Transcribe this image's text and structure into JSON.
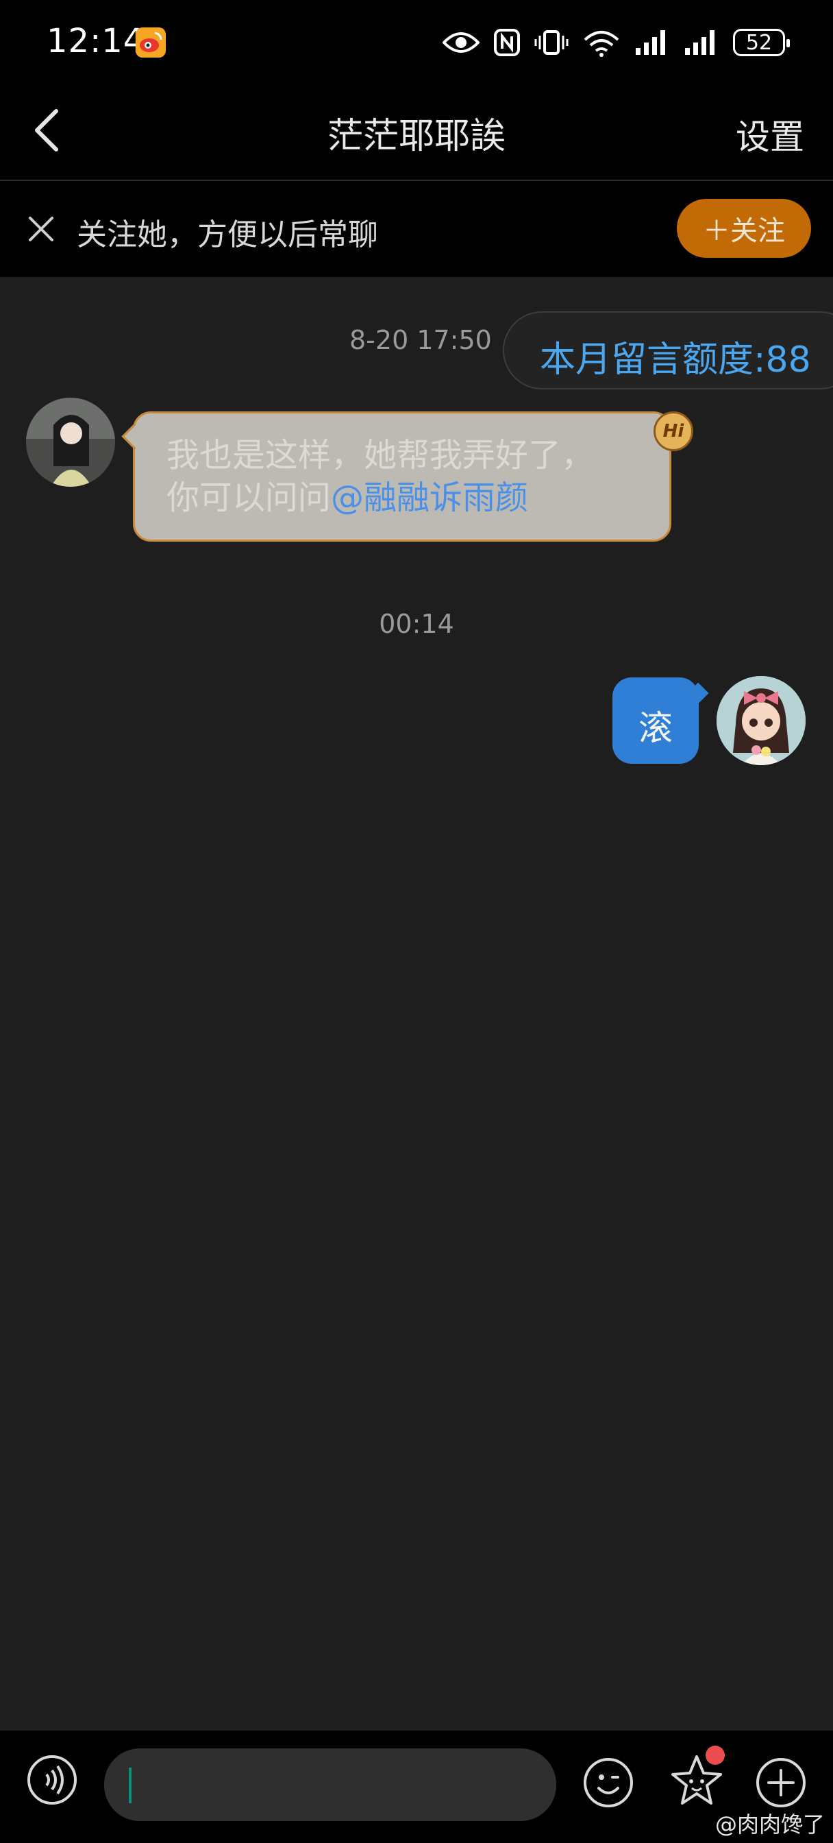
{
  "status_bar": {
    "time": "12:14",
    "battery": "52"
  },
  "nav": {
    "title": "茫茫耶耶誒",
    "settings_label": "设置"
  },
  "follow_banner": {
    "text": "关注她，方便以后常聊",
    "button_label": "＋关注"
  },
  "chat": {
    "timestamp_1": "8-20 17:50",
    "quota": "本月留言额度:88",
    "incoming": {
      "line1": "我也是这样，她帮我弄好了，",
      "line2_prefix": "你可以问问",
      "mention": "@融融诉雨颜",
      "badge": "Hi"
    },
    "timestamp_2": "00:14",
    "outgoing": {
      "text": "滚"
    }
  },
  "watermark": "@肉肉馋了"
}
